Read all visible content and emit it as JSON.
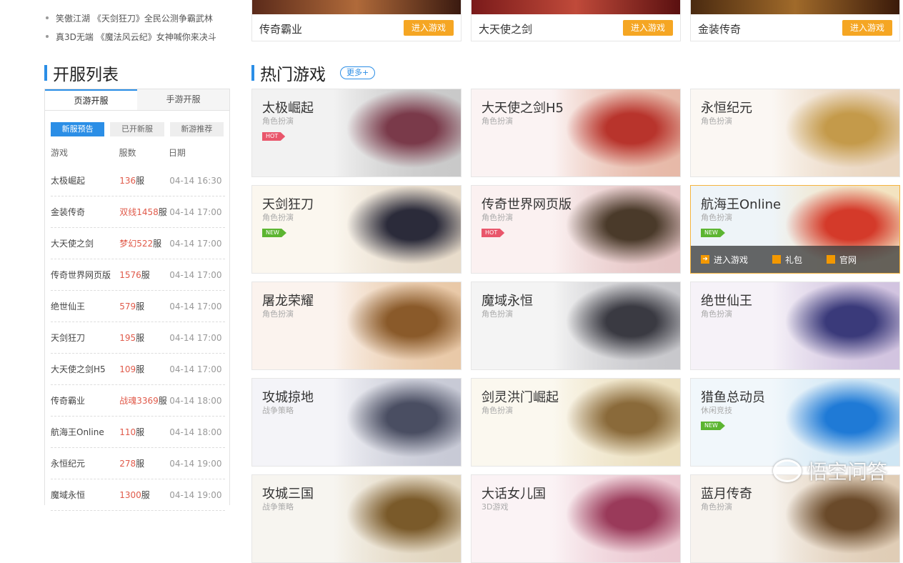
{
  "news": [
    "笑傲江湖 《天剑狂刀》全民公测争霸武林",
    "真3D无端 《魔法风云纪》女神喊你来决斗"
  ],
  "featured": [
    {
      "name": "传奇霸业",
      "button": "进入游戏",
      "strip": "#8a3b2b"
    },
    {
      "name": "大天使之剑",
      "button": "进入游戏",
      "strip": "#9b2a2a"
    },
    {
      "name": "金装传奇",
      "button": "进入游戏",
      "strip": "#6a3a1a"
    }
  ],
  "server_list": {
    "title": "开服列表",
    "tabs": [
      "页游开服",
      "手游开服"
    ],
    "subtabs": [
      "新服预告",
      "已开新服",
      "新游推荐"
    ],
    "headers": [
      "游戏",
      "服数",
      "日期"
    ],
    "rows": [
      {
        "game": "太极崛起",
        "server": "136",
        "suffix": "服",
        "date": "04-14 16:30"
      },
      {
        "game": "金装传奇",
        "server": "双线1458",
        "suffix": "服",
        "date": "04-14 17:00"
      },
      {
        "game": "大天使之剑",
        "server": "梦幻522",
        "suffix": "服",
        "date": "04-14 17:00"
      },
      {
        "game": "传奇世界网页版",
        "server": "1576",
        "suffix": "服",
        "date": "04-14 17:00"
      },
      {
        "game": "绝世仙王",
        "server": "579",
        "suffix": "服",
        "date": "04-14 17:00"
      },
      {
        "game": "天剑狂刀",
        "server": "195",
        "suffix": "服",
        "date": "04-14 17:00"
      },
      {
        "game": "大天使之剑H5",
        "server": "109",
        "suffix": "服",
        "date": "04-14 17:00"
      },
      {
        "game": "传奇霸业",
        "server": "战魂3369",
        "suffix": "服",
        "date": "04-14 18:00"
      },
      {
        "game": "航海王Online",
        "server": "110",
        "suffix": "服",
        "date": "04-14 18:00"
      },
      {
        "game": "永恒纪元",
        "server": "278",
        "suffix": "服",
        "date": "04-14 19:00"
      },
      {
        "game": "魔域永恒",
        "server": "1300",
        "suffix": "服",
        "date": "04-14 19:00"
      }
    ]
  },
  "hot_games": {
    "title": "热门游戏",
    "more": "更多+",
    "games": [
      {
        "name": "太极崛起",
        "category": "角色扮演",
        "badge": "HOT",
        "art": [
          "#f2f2f2",
          "#c9c9c9",
          "#7a3a4a"
        ]
      },
      {
        "name": "大天使之剑H5",
        "category": "角色扮演",
        "badge": "",
        "art": [
          "#fbf3f3",
          "#e7b9a8",
          "#b8342c"
        ]
      },
      {
        "name": "永恒纪元",
        "category": "角色扮演",
        "badge": "",
        "art": [
          "#fbf7f3",
          "#ead6c0",
          "#c49a4a"
        ]
      },
      {
        "name": "天剑狂刀",
        "category": "角色扮演",
        "badge": "NEW",
        "art": [
          "#fbf7ef",
          "#e8dccb",
          "#2b2b3a"
        ]
      },
      {
        "name": "传奇世界网页版",
        "category": "角色扮演",
        "badge": "HOT",
        "art": [
          "#fbf1f1",
          "#e6c6c6",
          "#4a3a2a"
        ]
      },
      {
        "name": "航海王Online",
        "category": "角色扮演",
        "badge": "NEW",
        "art": [
          "#eef4f8",
          "#f3e3c0",
          "#d43a2a"
        ]
      },
      {
        "name": "屠龙荣耀",
        "category": "角色扮演",
        "badge": "",
        "art": [
          "#fbf3ee",
          "#e9c9a8",
          "#8a5a2a"
        ]
      },
      {
        "name": "魔域永恒",
        "category": "角色扮演",
        "badge": "",
        "art": [
          "#f4f4f4",
          "#c8c8cc",
          "#3a3a42"
        ]
      },
      {
        "name": "绝世仙王",
        "category": "角色扮演",
        "badge": "",
        "art": [
          "#f6f2f8",
          "#d2c4e0",
          "#3a3a7a"
        ]
      },
      {
        "name": "攻城掠地",
        "category": "战争策略",
        "badge": "",
        "art": [
          "#f4f4f8",
          "#c8cad6",
          "#4a4e62"
        ]
      },
      {
        "name": "剑灵洪门崛起",
        "category": "角色扮演",
        "badge": "",
        "art": [
          "#fbf8ef",
          "#ece0c0",
          "#8a6a3a"
        ]
      },
      {
        "name": "猎鱼总动员",
        "category": "休闲竞技",
        "badge": "NEW",
        "art": [
          "#f1f7fb",
          "#cfe6f4",
          "#1f7ad6"
        ]
      },
      {
        "name": "攻城三国",
        "category": "战争策略",
        "badge": "",
        "art": [
          "#f7f5f0",
          "#e2d6bf",
          "#7a5a2a"
        ]
      },
      {
        "name": "大话女儿国",
        "category": "3D游戏",
        "badge": "",
        "art": [
          "#fbf3f5",
          "#ecc9d2",
          "#9a3a5a"
        ]
      },
      {
        "name": "蓝月传奇",
        "category": "角色扮演",
        "badge": "",
        "art": [
          "#f7f3ee",
          "#e0cdb6",
          "#6a4a2a"
        ]
      }
    ]
  },
  "hover_actions": [
    "进入游戏",
    "礼包",
    "官网"
  ],
  "watermark": "悟空问答",
  "colors": {
    "accent": "#2b8ee6",
    "server_red": "#e05a4a",
    "enter_orange": "#f5a623",
    "hot": "#e9566b",
    "new": "#5cb531"
  }
}
